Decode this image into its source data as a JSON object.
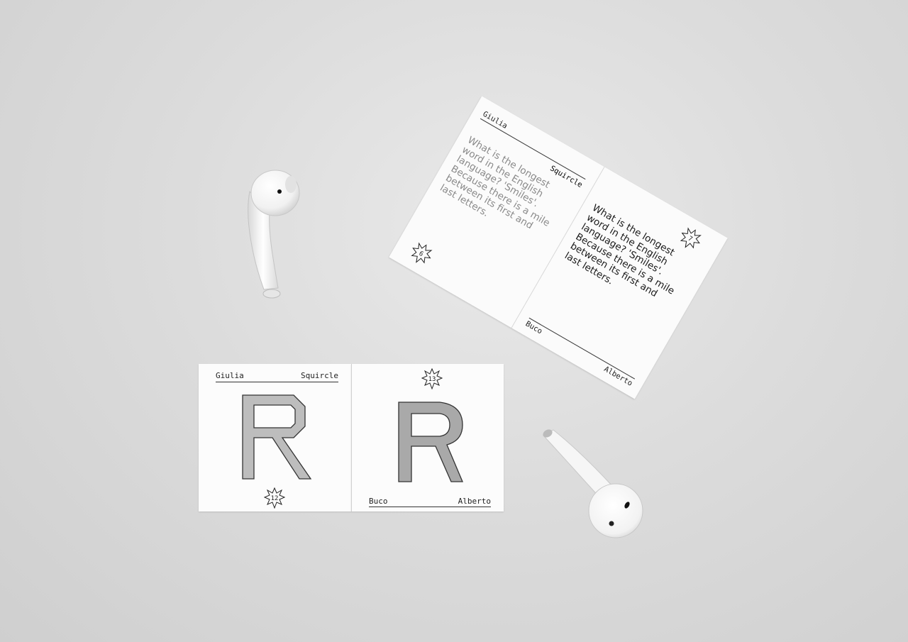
{
  "booklet": {
    "left_page": {
      "top_left": "Giulia",
      "top_right": "Squircle",
      "text_lines": [
        "What is the longest",
        "word in the English",
        "language? 'Smiles'.",
        "Because there is a mile",
        "between its first and",
        "last letters."
      ],
      "page_number": "6"
    },
    "right_page": {
      "text_lines": [
        "What is the longest",
        "word in the English",
        "language? 'Smiles'.",
        "Because there is a mile",
        "between its first and",
        "last letters."
      ],
      "bottom_left": "Buco",
      "bottom_right": "Alberto",
      "page_number": "7"
    }
  },
  "cards": {
    "left": {
      "top_left": "Giulia",
      "top_right": "Squircle",
      "letter": "R",
      "page_number": "12"
    },
    "right": {
      "letter": "R",
      "page_number": "13",
      "bottom_left": "Buco",
      "bottom_right": "Alberto"
    }
  },
  "objects": {
    "earbud_top": "earbud-icon",
    "earbud_bottom": "earbud-icon"
  }
}
